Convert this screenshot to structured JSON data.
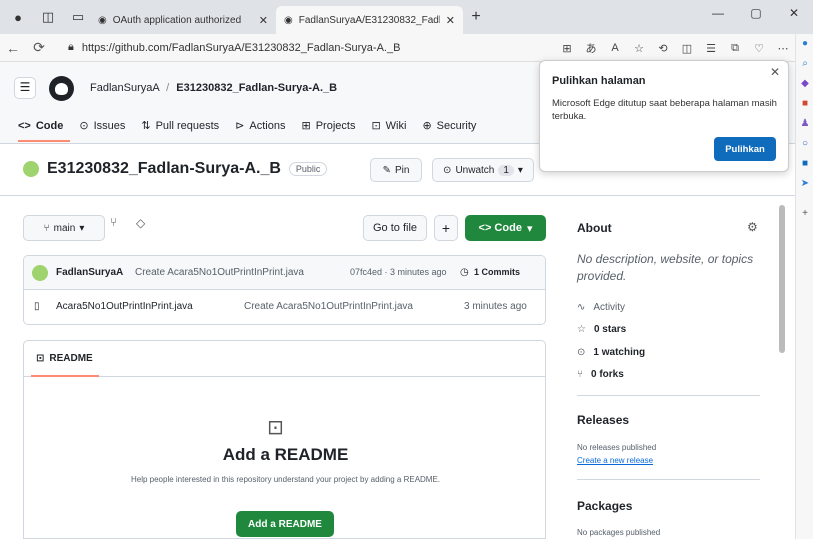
{
  "browser": {
    "tabs": [
      {
        "title": "OAuth application authorized",
        "active": false
      },
      {
        "title": "FadlanSuryaA/E31230832_Fadlan",
        "active": true
      }
    ],
    "url": "https://github.com/FadlanSuryaA/E31230832_Fadlan-Surya-A._B",
    "window_controls": [
      "—",
      "▢",
      "✕"
    ]
  },
  "github": {
    "breadcrumb_owner": "FadlanSuryaA",
    "breadcrumb_sep": "/",
    "breadcrumb_repo": "E31230832_Fadlan-Surya-A._B",
    "nav": [
      "Code",
      "Issues",
      "Pull requests",
      "Actions",
      "Projects",
      "Wiki",
      "Security"
    ],
    "repo_name": "E31230832_Fadlan-Surya-A._B",
    "visibility": "Public",
    "pin_label": "Pin",
    "unwatch_label": "Unwatch",
    "unwatch_count": "1",
    "branch": "main",
    "go_to_file": "Go to file",
    "plus": "+",
    "code_button": "<> Code",
    "commit": {
      "author": "FadlanSuryaA",
      "message": "Create Acara5No1OutPrintInPrint.java",
      "hash_time": "07fc4ed · 3 minutes ago",
      "commits": "1 Commits"
    },
    "files": [
      {
        "name": "Acara5No1OutPrintInPrint.java",
        "message": "Create Acara5No1OutPrintInPrint.java",
        "time": "3 minutes ago"
      }
    ],
    "readme": {
      "tab": "README",
      "title": "Add a README",
      "subtitle": "Help people interested in this repository understand your project by adding a README.",
      "button": "Add a README"
    },
    "about": {
      "heading": "About",
      "description": "No description, website, or topics provided.",
      "activity": "Activity",
      "stars": "0 stars",
      "watching": "1 watching",
      "forks": "0 forks"
    },
    "releases": {
      "heading": "Releases",
      "none": "No releases published",
      "create": "Create a new release"
    },
    "packages": {
      "heading": "Packages",
      "none": "No packages published"
    }
  },
  "popup": {
    "title": "Pulihkan halaman",
    "message": "Microsoft Edge ditutup saat beberapa halaman masih terbuka.",
    "button": "Pulihkan"
  },
  "colors": {
    "green": "#1f883d",
    "edge_blue": "#0f6cbd",
    "accent_underline": "#fd8c73"
  }
}
